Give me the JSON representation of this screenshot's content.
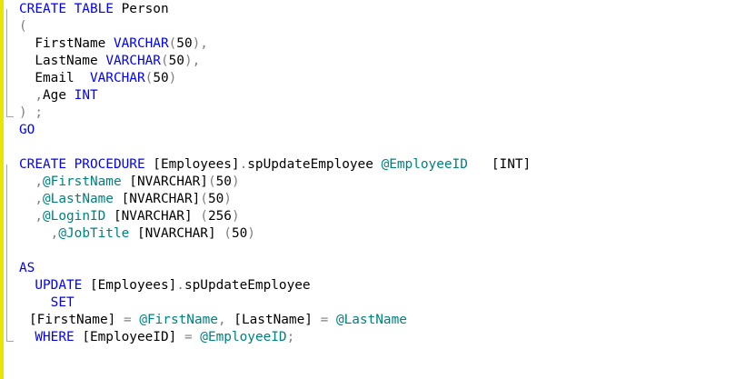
{
  "colors": {
    "keyword": "#0000ff",
    "variable": "#008080",
    "punctuation": "#808080",
    "text": "#000000",
    "change_bar": "#e6e600"
  },
  "code_lines": [
    [
      [
        "kw",
        "CREATE TABLE"
      ],
      [
        "tx",
        " Person"
      ]
    ],
    [
      [
        "gr",
        "("
      ]
    ],
    [
      [
        "tx",
        "  FirstName "
      ],
      [
        "tp",
        "VARCHAR"
      ],
      [
        "gr",
        "("
      ],
      [
        "tx",
        "50"
      ],
      [
        "gr",
        "),"
      ]
    ],
    [
      [
        "tx",
        "  LastName "
      ],
      [
        "tp",
        "VARCHAR"
      ],
      [
        "gr",
        "("
      ],
      [
        "tx",
        "50"
      ],
      [
        "gr",
        "),"
      ]
    ],
    [
      [
        "tx",
        "  Email  "
      ],
      [
        "tp",
        "VARCHAR"
      ],
      [
        "gr",
        "("
      ],
      [
        "tx",
        "50"
      ],
      [
        "gr",
        ")"
      ]
    ],
    [
      [
        "gr",
        "  ,"
      ],
      [
        "tx",
        "Age "
      ],
      [
        "tp",
        "INT"
      ]
    ],
    [
      [
        "gr",
        ") ;"
      ]
    ],
    [
      [
        "kw",
        "GO"
      ]
    ],
    [],
    [
      [
        "kw",
        "CREATE PROCEDURE"
      ],
      [
        "tx",
        " [Employees]"
      ],
      [
        "gr",
        "."
      ],
      [
        "tx",
        "spUpdateEmployee "
      ],
      [
        "vr",
        "@EmployeeID"
      ],
      [
        "tx",
        "   [INT]"
      ]
    ],
    [
      [
        "gr",
        "  ,"
      ],
      [
        "vr",
        "@FirstName"
      ],
      [
        "tx",
        " [NVARCHAR]"
      ],
      [
        "gr",
        "("
      ],
      [
        "tx",
        "50"
      ],
      [
        "gr",
        ")"
      ]
    ],
    [
      [
        "gr",
        "  ,"
      ],
      [
        "vr",
        "@LastName"
      ],
      [
        "tx",
        " [NVARCHAR]"
      ],
      [
        "gr",
        "("
      ],
      [
        "tx",
        "50"
      ],
      [
        "gr",
        ")"
      ]
    ],
    [
      [
        "gr",
        "  ,"
      ],
      [
        "vr",
        "@LoginID"
      ],
      [
        "tx",
        " [NVARCHAR] "
      ],
      [
        "gr",
        "("
      ],
      [
        "tx",
        "256"
      ],
      [
        "gr",
        ")"
      ]
    ],
    [
      [
        "gr",
        "    ,"
      ],
      [
        "vr",
        "@JobTitle"
      ],
      [
        "tx",
        " [NVARCHAR] "
      ],
      [
        "gr",
        "("
      ],
      [
        "tx",
        "50"
      ],
      [
        "gr",
        ")"
      ]
    ],
    [],
    [
      [
        "kw",
        "AS"
      ]
    ],
    [
      [
        "kw",
        "  UPDATE"
      ],
      [
        "tx",
        " [Employees]"
      ],
      [
        "gr",
        "."
      ],
      [
        "tx",
        "spUpdateEmployee"
      ]
    ],
    [
      [
        "kw",
        "    SET"
      ]
    ],
    [
      [
        "tx",
        "[FirstName] "
      ],
      [
        "gr",
        "="
      ],
      [
        "tx",
        " "
      ],
      [
        "vr",
        "@FirstName"
      ],
      [
        "gr",
        ","
      ],
      [
        "tx",
        " [LastName] "
      ],
      [
        "gr",
        "="
      ],
      [
        "tx",
        " "
      ],
      [
        "vr",
        "@LastName"
      ]
    ],
    [
      [
        "kw",
        "  WHERE"
      ],
      [
        "tx",
        " [EmployeeID] "
      ],
      [
        "gr",
        "="
      ],
      [
        "tx",
        " "
      ],
      [
        "vr",
        "@EmployeeID"
      ],
      [
        "gr",
        ";"
      ]
    ]
  ]
}
